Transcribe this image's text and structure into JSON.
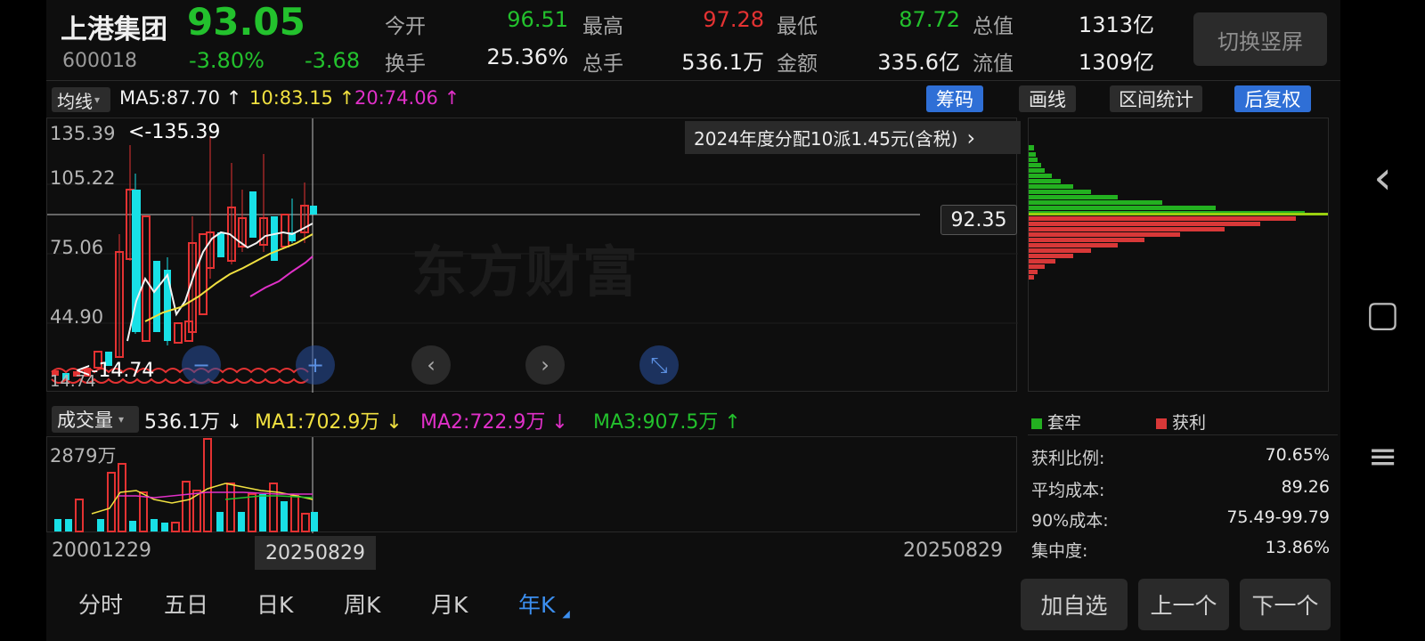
{
  "header": {
    "name": "上港集团",
    "price": "93.05",
    "code": "600018",
    "change_pct": "-3.80%",
    "change": "-3.68",
    "fields": [
      {
        "label": "今开",
        "value": "96.51",
        "color": "#23c12d"
      },
      {
        "label": "最高",
        "value": "97.28",
        "color": "#e43232"
      },
      {
        "label": "最低",
        "value": "87.72",
        "color": "#23c12d"
      },
      {
        "label": "总值",
        "value": "1313亿",
        "color": "#eeeeee"
      },
      {
        "label": "换手",
        "value": "25.36%",
        "color": "#eeeeee"
      },
      {
        "label": "总手",
        "value": "536.1万",
        "color": "#eeeeee"
      },
      {
        "label": "金额",
        "value": "335.6亿",
        "color": "#eeeeee"
      },
      {
        "label": "流值",
        "value": "1309亿",
        "color": "#eeeeee"
      }
    ],
    "switch_button": "切换竖屏"
  },
  "ma_row": {
    "selector": "均线",
    "ma5": "MA5:87.70 ↑",
    "ma10": "10:83.15 ↑",
    "ma20": "20:74.06 ↑",
    "chips_btn": "筹码",
    "draw_btn": "画线",
    "range_btn": "区间统计",
    "adjust_btn": "后复权"
  },
  "main_chart": {
    "y_labels": [
      "135.39",
      "105.22",
      "75.06",
      "44.90"
    ],
    "max_marker": "<-135.39",
    "min_marker": "<-14.74",
    "bottom_label": "14.74",
    "dividend": "2024年度分配10派1.45元(含税)",
    "dividend_arrow": "›",
    "crosshair_price": "92.35",
    "watermark": "东方财富"
  },
  "controls": {
    "zoom_out": "−",
    "zoom_in": "+",
    "prev": "‹",
    "next": "›",
    "collapse": "⤡"
  },
  "volume_row": {
    "selector": "成交量",
    "vol": "536.1万 ↓",
    "ma1": "MA1:702.9万 ↓",
    "ma2": "MA2:722.9万 ↓",
    "ma3": "MA3:907.5万 ↑",
    "y_label": "2879万"
  },
  "dates": {
    "start": "20001229",
    "cursor": "20250829",
    "end": "20250829"
  },
  "tabs": [
    {
      "label": "分时"
    },
    {
      "label": "五日"
    },
    {
      "label": "日K"
    },
    {
      "label": "周K"
    },
    {
      "label": "月K"
    },
    {
      "label": "年K"
    }
  ],
  "chips_panel": {
    "legend_trapped": "套牢",
    "legend_profit": "获利",
    "stats": [
      {
        "label": "获利比例:",
        "value": "70.65%"
      },
      {
        "label": "平均成本:",
        "value": "89.26"
      },
      {
        "label": "90%成本:",
        "value": "75.49-99.79"
      },
      {
        "label": "集中度:",
        "value": "13.86%"
      }
    ]
  },
  "bottom_buttons": {
    "add": "加自选",
    "prev": "上一个",
    "next": "下一个"
  },
  "nav": {
    "back_icon": "‹",
    "home_icon": "▢",
    "menu_icon": "≡"
  },
  "colors": {
    "up": "#e43232",
    "down": "#23c12d",
    "candle_down": "#18e0e6",
    "ma5": "#f2f2f2",
    "ma10": "#f0e040",
    "ma20": "#e030c8",
    "accent": "#3c8ff0"
  }
}
